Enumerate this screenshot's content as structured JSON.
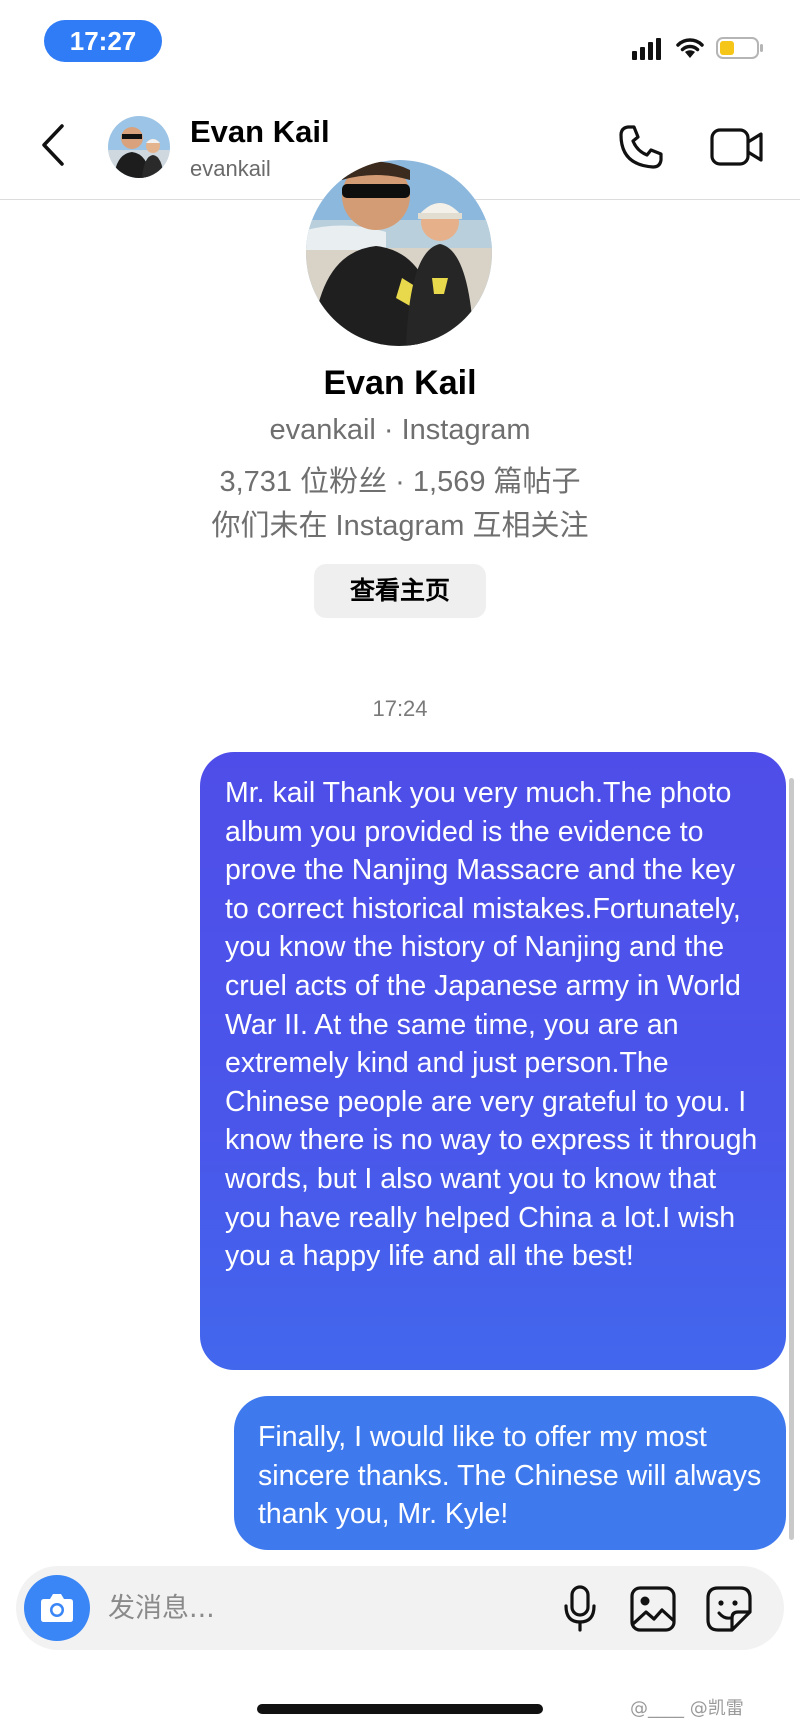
{
  "status_bar": {
    "time": "17:27",
    "icons": [
      "signal-icon",
      "wifi-icon",
      "battery-icon"
    ]
  },
  "header": {
    "name": "Evan Kail",
    "username": "evankail",
    "icons": [
      "back-icon",
      "phone-icon",
      "video-icon"
    ]
  },
  "profile": {
    "name": "Evan Kail",
    "subtitle": "evankail · Instagram",
    "stats": "3,731 位粉丝 · 1,569 篇帖子",
    "mutual": "你们未在 Instagram 互相关注",
    "view_profile_label": "查看主页"
  },
  "conversation": {
    "timestamp": "17:24",
    "messages": [
      {
        "sender": "me",
        "text": "Mr. kail Thank you very much.The photo album you provided is the evidence to prove the Nanjing Massacre and the key to correct historical mistakes.Fortunately, you know the history of Nanjing and the cruel acts of the Japanese army in World War II. At the same time, you are an extremely kind and just person.The Chinese people are very grateful to you. I know there is no way to express it through words, but I also want you to know that you have really helped China a lot.I wish you a happy life and all the best!"
      },
      {
        "sender": "me",
        "text": "Finally, I would like to offer my most sincere thanks. The Chinese will always thank you, Mr. Kyle!"
      }
    ]
  },
  "composer": {
    "placeholder": "发消息...",
    "icons": [
      "camera-icon",
      "microphone-icon",
      "gallery-icon",
      "sticker-icon"
    ]
  },
  "watermark": "@____ @凯雷",
  "colors": {
    "time_pill": "#2f7cf6",
    "bubble_gradient_top": "#4f4de9",
    "bubble_gradient_bottom": "#4267ed",
    "bubble_second": "#3f79ee",
    "camera_button": "#3a86f6"
  }
}
